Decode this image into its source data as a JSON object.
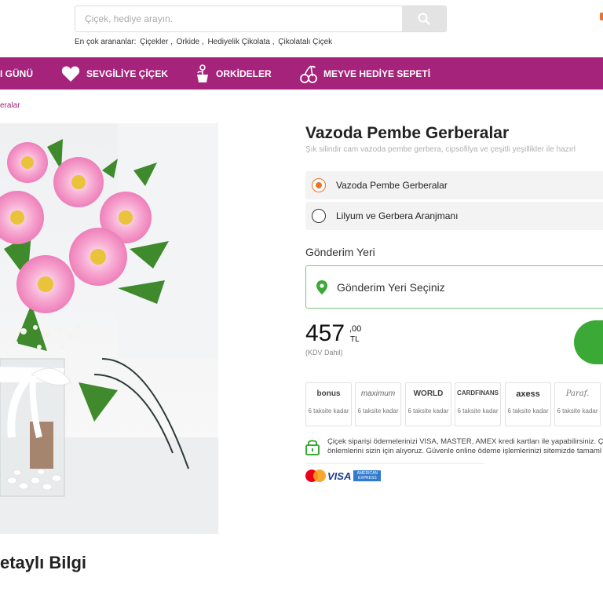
{
  "search": {
    "placeholder": "Çiçek, hediye arayın."
  },
  "popular": {
    "label": "En çok arananlar:",
    "links": [
      "Çiçekler ,",
      "Orkide ,",
      "Hediyelik Çikolata ,",
      "Çikolatalı Çiçek"
    ]
  },
  "nav": {
    "items": [
      {
        "label": "I GÜNÜ",
        "icon": "none"
      },
      {
        "label": "SEVGİLİYE ÇİÇEK",
        "icon": "heart-icon"
      },
      {
        "label": "ORKİDELER",
        "icon": "orchid-pot-icon"
      },
      {
        "label": "MEYVE HEDİYE SEPETİ",
        "icon": "cherry-icon"
      }
    ]
  },
  "breadcrumb": "eralar",
  "product": {
    "title": "Vazoda Pembe Gerberalar",
    "subtitle": "Şık silindir cam vazoda pembe gerbera, cipsofilya ve çeşitli yeşillikler ile hazırl",
    "options": [
      {
        "label": "Vazoda Pembe Gerberalar",
        "selected": true
      },
      {
        "label": "Lilyum ve Gerbera Aranjmanı",
        "selected": false
      }
    ],
    "delivery_label": "Gönderim Yeri",
    "delivery_placeholder": "Gönderim Yeri Seçiniz",
    "price_int": "457",
    "price_dec": ",00",
    "currency": "TL",
    "tax_note": "(KDV Dahil)"
  },
  "cards": [
    {
      "logo": "bonus",
      "installment": "6 taksite kadar"
    },
    {
      "logo": "maximum",
      "installment": "6 taksite kadar"
    },
    {
      "logo": "WORLD",
      "installment": "6 taksite kadar"
    },
    {
      "logo": "CARDFINANS",
      "installment": "6 taksite kadar"
    },
    {
      "logo": "axess",
      "installment": "6 taksite kadar"
    },
    {
      "logo": "Paraf.",
      "installment": "6 taksite kadar"
    }
  ],
  "secure": {
    "line1": "Çiçek siparişi ödemelerinizi VISA, MASTER, AMEX kredi kartları ile yapabilirsiniz. Çiçe",
    "line2": "önlemlerini sizin için alıyoruz. Güvenle online ödeme işlemlerinizi sitemizde tamaml"
  },
  "payment_logos": {
    "visa": "VISA",
    "amex": "AMERICAN EXPRESS"
  },
  "detail_heading": "etaylı Bilgi",
  "colors": {
    "brand": "#a5237a",
    "accent": "#e8732b",
    "buy": "#3aa935"
  }
}
